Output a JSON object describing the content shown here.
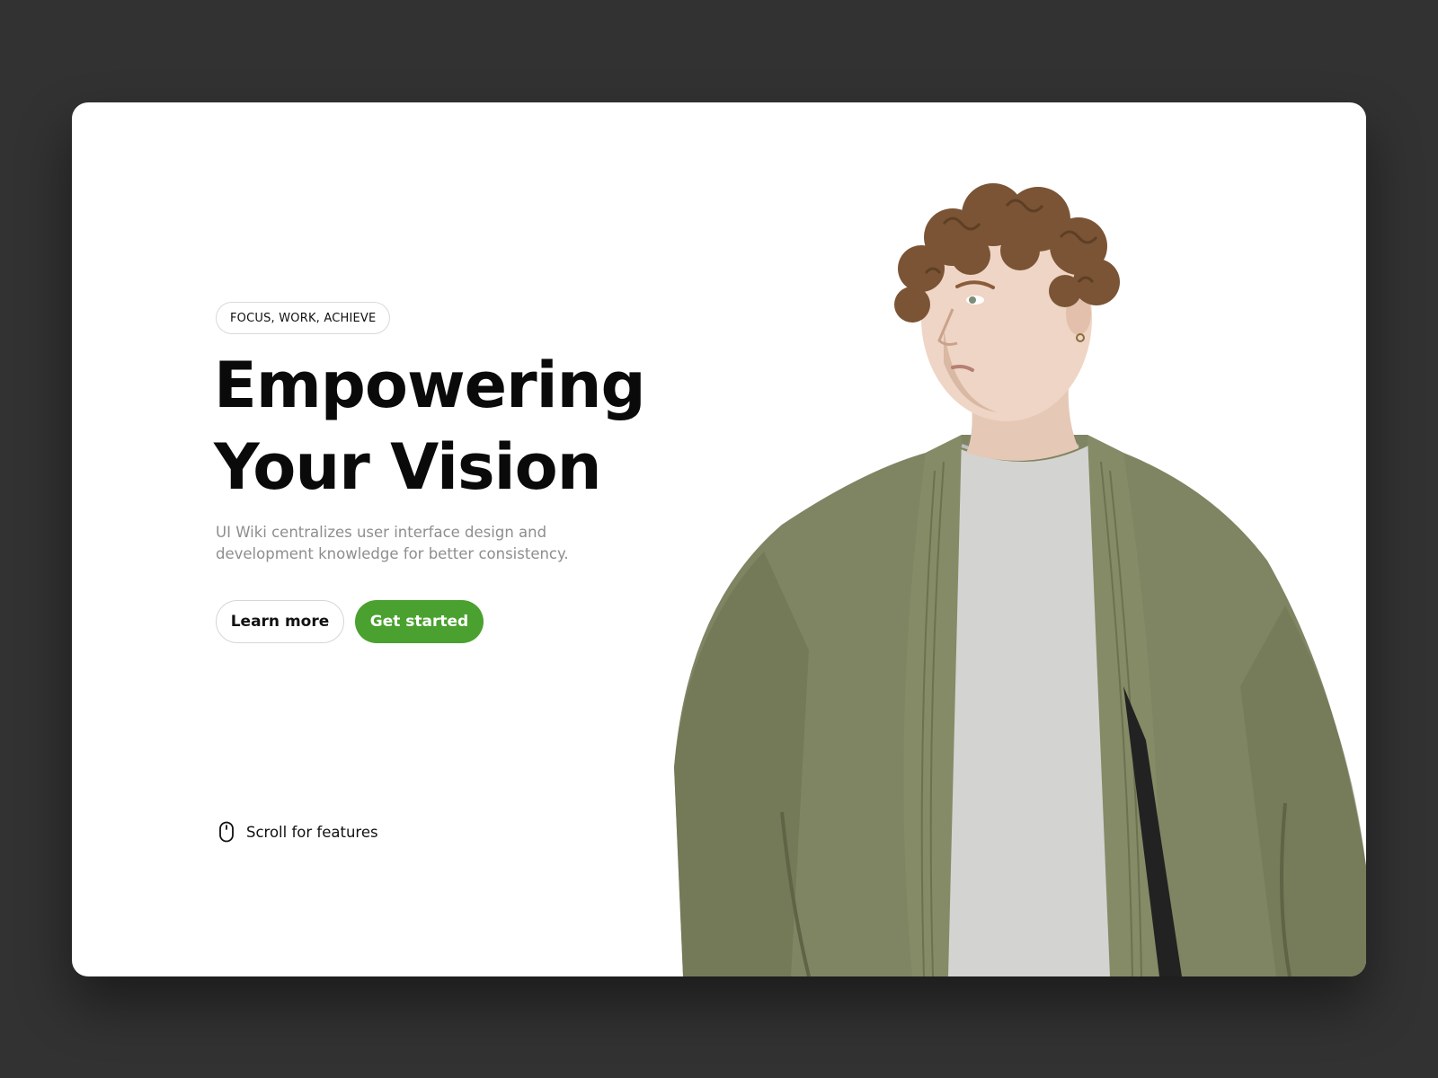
{
  "hero": {
    "tag": "FOCUS, WORK, ACHIEVE",
    "headline_line1": "Empowering",
    "headline_line2": "Your Vision",
    "subtitle": "UI Wiki centralizes user interface design and development knowledge for better consistency.",
    "learn_more_label": "Learn more",
    "get_started_label": "Get started",
    "scroll_label": "Scroll for features"
  },
  "icons": {
    "scroll": "mouse-icon"
  },
  "colors": {
    "page_background": "#323232",
    "card_background": "#ffffff",
    "accent_green": "#4aa12f",
    "headline": "#0a0a0a",
    "subtitle": "#8e8e8e",
    "jacket": "#7f8562",
    "shirt": "#d3d3d1",
    "hair": "#7a5434"
  }
}
